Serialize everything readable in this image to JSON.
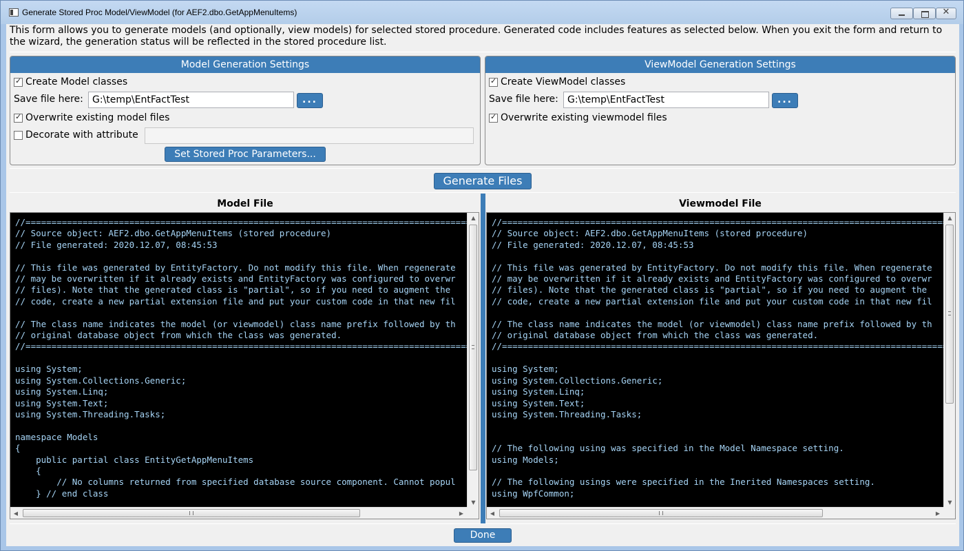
{
  "window": {
    "title": "Generate Stored Proc Model/ViewModel (for AEF2.dbo.GetAppMenuItems)",
    "close_glyph": "✕"
  },
  "description": "This form allows you to generate models (and optionally, view models) for selected stored procedure. Generated code includes features as selected below. When you exit the form and return to the wizard, the generation status will be reflected in the stored procedure list.",
  "model_settings": {
    "header": "Model Generation Settings",
    "create_label": "Create Model classes",
    "create_checked": true,
    "save_label": "Save file here:",
    "save_value": "G:\\temp\\EntFactTest",
    "browse_label": "...",
    "overwrite_label": "Overwrite existing model files",
    "overwrite_checked": true,
    "decorate_label": "Decorate with attribute",
    "decorate_checked": false,
    "decorate_value": "",
    "params_button": "Set Stored Proc Parameters..."
  },
  "viewmodel_settings": {
    "header": "ViewModel Generation Settings",
    "create_label": "Create ViewModel classes",
    "create_checked": true,
    "save_label": "Save file here:",
    "save_value": "G:\\temp\\EntFactTest",
    "browse_label": "...",
    "overwrite_label": "Overwrite existing viewmodel files",
    "overwrite_checked": true
  },
  "generate_button": "Generate Files",
  "model_file": {
    "title": "Model File",
    "code": "//=======================================================================================================\n// Source object: AEF2.dbo.GetAppMenuItems (stored procedure)\n// File generated: 2020.12.07, 08:45:53\n\n// This file was generated by EntityFactory. Do not modify this file. When regenerate\n// may be overwritten if it already exists and EntityFactory was configured to overwr\n// files). Note that the generated class is \"partial\", so if you need to augment the\n// code, create a new partial extension file and put your custom code in that new fil\n\n// The class name indicates the model (or viewmodel) class name prefix followed by th\n// original database object from which the class was generated.\n//=======================================================================================================\n\nusing System;\nusing System.Collections.Generic;\nusing System.Linq;\nusing System.Text;\nusing System.Threading.Tasks;\n\nnamespace Models\n{\n    public partial class EntityGetAppMenuItems\n    {\n        // No columns returned from specified database source component. Cannot popul\n    } // end class"
  },
  "viewmodel_file": {
    "title": "Viewmodel File",
    "code": "//=======================================================================================================\n// Source object: AEF2.dbo.GetAppMenuItems (stored procedure)\n// File generated: 2020.12.07, 08:45:53\n\n// This file was generated by EntityFactory. Do not modify this file. When regenerate\n// may be overwritten if it already exists and EntityFactory was configured to overwr\n// files). Note that the generated class is \"partial\", so if you need to augment the\n// code, create a new partial extension file and put your custom code in that new fil\n\n// The class name indicates the model (or viewmodel) class name prefix followed by th\n// original database object from which the class was generated.\n//=======================================================================================================\n\nusing System;\nusing System.Collections.Generic;\nusing System.Linq;\nusing System.Text;\nusing System.Threading.Tasks;\n\n\n// The following using was specified in the Model Namespace setting.\nusing Models;\n\n// The following usings were specified in the Inerited Namespaces setting.\nusing WpfCommon;"
  },
  "done_button": "Done",
  "colors": {
    "accent": "#3d7db7",
    "code_text": "#a6d4f5",
    "code_background": "#000000"
  }
}
